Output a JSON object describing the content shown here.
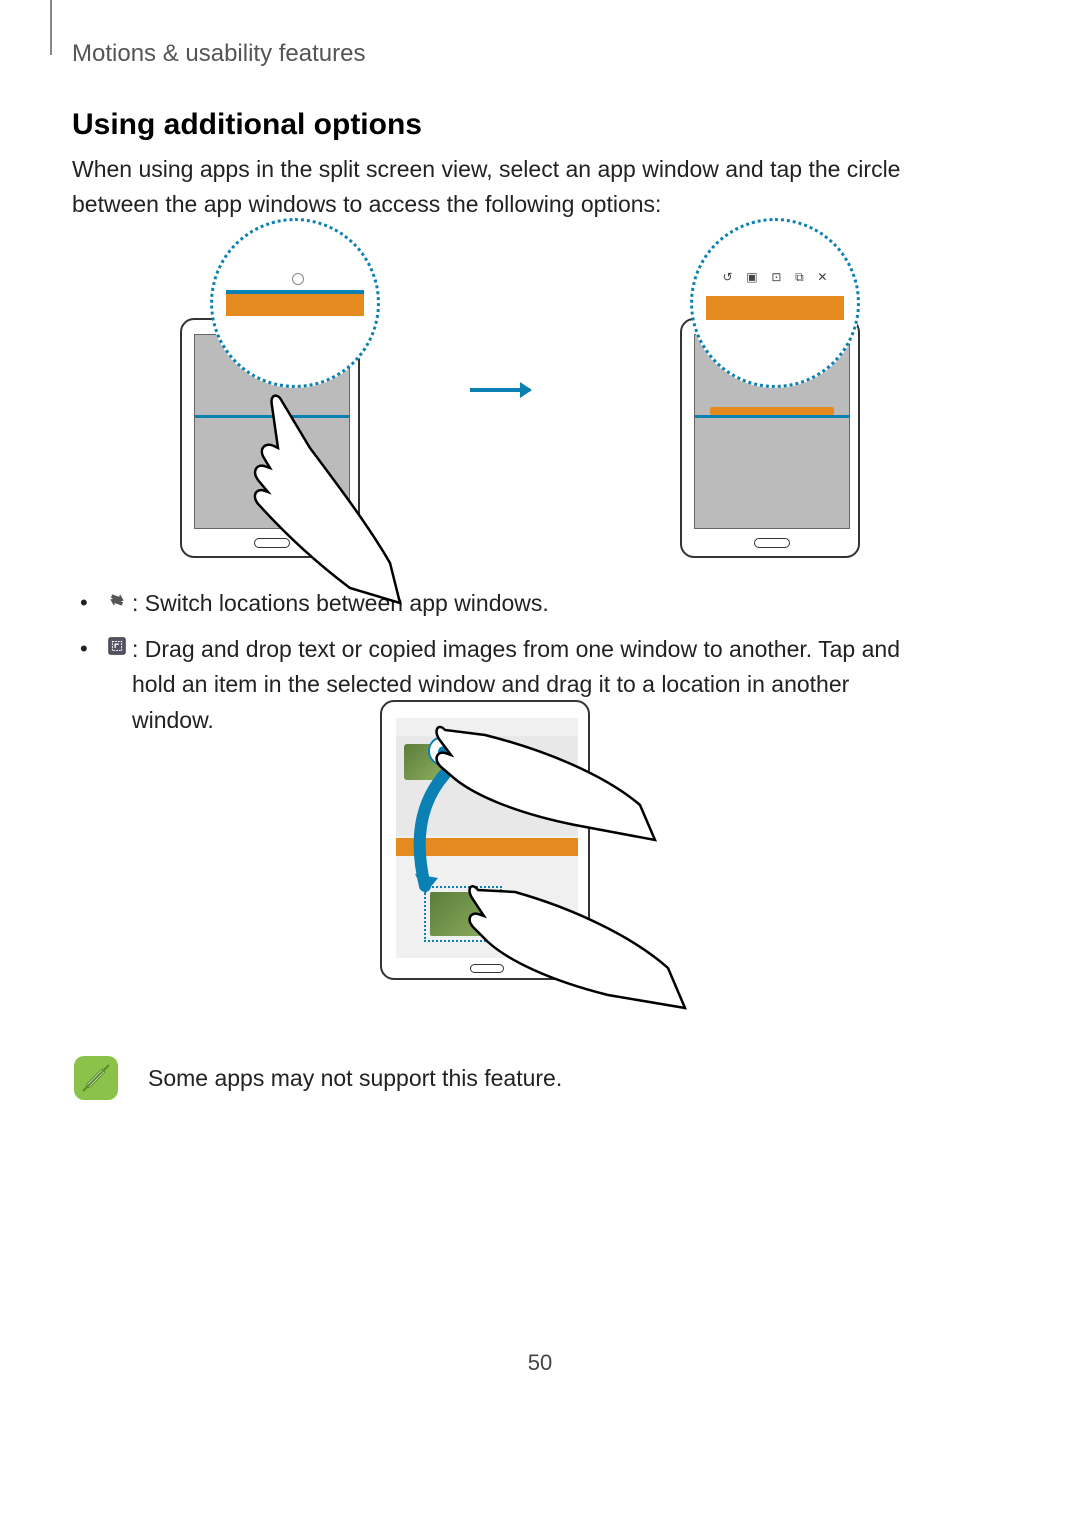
{
  "breadcrumb": "Motions & usability features",
  "section_title": "Using additional options",
  "intro": "When using apps in the split screen view, select an app window and tap the circle between the app windows to access the following options:",
  "bullets": {
    "switch": ": Switch locations between app windows.",
    "drag": ": Drag and drop text or copied images from one window to another. Tap and hold an item in the selected window and drag it to a location in another window."
  },
  "note": "Some apps may not support this feature.",
  "toolbar_icons": {
    "switch": "↺",
    "drag": "▣",
    "max": "⊡",
    "popup": "⧉",
    "close": "✕"
  },
  "page_number": "50"
}
